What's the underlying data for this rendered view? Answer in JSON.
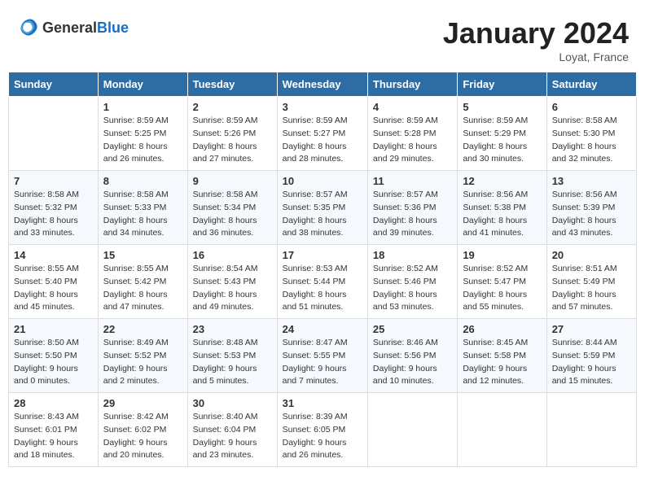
{
  "logo": {
    "general": "General",
    "blue": "Blue"
  },
  "title": "January 2024",
  "location": "Loyat, France",
  "days_of_week": [
    "Sunday",
    "Monday",
    "Tuesday",
    "Wednesday",
    "Thursday",
    "Friday",
    "Saturday"
  ],
  "weeks": [
    [
      {
        "day": "",
        "sunrise": "",
        "sunset": "",
        "daylight": ""
      },
      {
        "day": "1",
        "sunrise": "Sunrise: 8:59 AM",
        "sunset": "Sunset: 5:25 PM",
        "daylight": "Daylight: 8 hours and 26 minutes."
      },
      {
        "day": "2",
        "sunrise": "Sunrise: 8:59 AM",
        "sunset": "Sunset: 5:26 PM",
        "daylight": "Daylight: 8 hours and 27 minutes."
      },
      {
        "day": "3",
        "sunrise": "Sunrise: 8:59 AM",
        "sunset": "Sunset: 5:27 PM",
        "daylight": "Daylight: 8 hours and 28 minutes."
      },
      {
        "day": "4",
        "sunrise": "Sunrise: 8:59 AM",
        "sunset": "Sunset: 5:28 PM",
        "daylight": "Daylight: 8 hours and 29 minutes."
      },
      {
        "day": "5",
        "sunrise": "Sunrise: 8:59 AM",
        "sunset": "Sunset: 5:29 PM",
        "daylight": "Daylight: 8 hours and 30 minutes."
      },
      {
        "day": "6",
        "sunrise": "Sunrise: 8:58 AM",
        "sunset": "Sunset: 5:30 PM",
        "daylight": "Daylight: 8 hours and 32 minutes."
      }
    ],
    [
      {
        "day": "7",
        "sunrise": "Sunrise: 8:58 AM",
        "sunset": "Sunset: 5:32 PM",
        "daylight": "Daylight: 8 hours and 33 minutes."
      },
      {
        "day": "8",
        "sunrise": "Sunrise: 8:58 AM",
        "sunset": "Sunset: 5:33 PM",
        "daylight": "Daylight: 8 hours and 34 minutes."
      },
      {
        "day": "9",
        "sunrise": "Sunrise: 8:58 AM",
        "sunset": "Sunset: 5:34 PM",
        "daylight": "Daylight: 8 hours and 36 minutes."
      },
      {
        "day": "10",
        "sunrise": "Sunrise: 8:57 AM",
        "sunset": "Sunset: 5:35 PM",
        "daylight": "Daylight: 8 hours and 38 minutes."
      },
      {
        "day": "11",
        "sunrise": "Sunrise: 8:57 AM",
        "sunset": "Sunset: 5:36 PM",
        "daylight": "Daylight: 8 hours and 39 minutes."
      },
      {
        "day": "12",
        "sunrise": "Sunrise: 8:56 AM",
        "sunset": "Sunset: 5:38 PM",
        "daylight": "Daylight: 8 hours and 41 minutes."
      },
      {
        "day": "13",
        "sunrise": "Sunrise: 8:56 AM",
        "sunset": "Sunset: 5:39 PM",
        "daylight": "Daylight: 8 hours and 43 minutes."
      }
    ],
    [
      {
        "day": "14",
        "sunrise": "Sunrise: 8:55 AM",
        "sunset": "Sunset: 5:40 PM",
        "daylight": "Daylight: 8 hours and 45 minutes."
      },
      {
        "day": "15",
        "sunrise": "Sunrise: 8:55 AM",
        "sunset": "Sunset: 5:42 PM",
        "daylight": "Daylight: 8 hours and 47 minutes."
      },
      {
        "day": "16",
        "sunrise": "Sunrise: 8:54 AM",
        "sunset": "Sunset: 5:43 PM",
        "daylight": "Daylight: 8 hours and 49 minutes."
      },
      {
        "day": "17",
        "sunrise": "Sunrise: 8:53 AM",
        "sunset": "Sunset: 5:44 PM",
        "daylight": "Daylight: 8 hours and 51 minutes."
      },
      {
        "day": "18",
        "sunrise": "Sunrise: 8:52 AM",
        "sunset": "Sunset: 5:46 PM",
        "daylight": "Daylight: 8 hours and 53 minutes."
      },
      {
        "day": "19",
        "sunrise": "Sunrise: 8:52 AM",
        "sunset": "Sunset: 5:47 PM",
        "daylight": "Daylight: 8 hours and 55 minutes."
      },
      {
        "day": "20",
        "sunrise": "Sunrise: 8:51 AM",
        "sunset": "Sunset: 5:49 PM",
        "daylight": "Daylight: 8 hours and 57 minutes."
      }
    ],
    [
      {
        "day": "21",
        "sunrise": "Sunrise: 8:50 AM",
        "sunset": "Sunset: 5:50 PM",
        "daylight": "Daylight: 9 hours and 0 minutes."
      },
      {
        "day": "22",
        "sunrise": "Sunrise: 8:49 AM",
        "sunset": "Sunset: 5:52 PM",
        "daylight": "Daylight: 9 hours and 2 minutes."
      },
      {
        "day": "23",
        "sunrise": "Sunrise: 8:48 AM",
        "sunset": "Sunset: 5:53 PM",
        "daylight": "Daylight: 9 hours and 5 minutes."
      },
      {
        "day": "24",
        "sunrise": "Sunrise: 8:47 AM",
        "sunset": "Sunset: 5:55 PM",
        "daylight": "Daylight: 9 hours and 7 minutes."
      },
      {
        "day": "25",
        "sunrise": "Sunrise: 8:46 AM",
        "sunset": "Sunset: 5:56 PM",
        "daylight": "Daylight: 9 hours and 10 minutes."
      },
      {
        "day": "26",
        "sunrise": "Sunrise: 8:45 AM",
        "sunset": "Sunset: 5:58 PM",
        "daylight": "Daylight: 9 hours and 12 minutes."
      },
      {
        "day": "27",
        "sunrise": "Sunrise: 8:44 AM",
        "sunset": "Sunset: 5:59 PM",
        "daylight": "Daylight: 9 hours and 15 minutes."
      }
    ],
    [
      {
        "day": "28",
        "sunrise": "Sunrise: 8:43 AM",
        "sunset": "Sunset: 6:01 PM",
        "daylight": "Daylight: 9 hours and 18 minutes."
      },
      {
        "day": "29",
        "sunrise": "Sunrise: 8:42 AM",
        "sunset": "Sunset: 6:02 PM",
        "daylight": "Daylight: 9 hours and 20 minutes."
      },
      {
        "day": "30",
        "sunrise": "Sunrise: 8:40 AM",
        "sunset": "Sunset: 6:04 PM",
        "daylight": "Daylight: 9 hours and 23 minutes."
      },
      {
        "day": "31",
        "sunrise": "Sunrise: 8:39 AM",
        "sunset": "Sunset: 6:05 PM",
        "daylight": "Daylight: 9 hours and 26 minutes."
      },
      {
        "day": "",
        "sunrise": "",
        "sunset": "",
        "daylight": ""
      },
      {
        "day": "",
        "sunrise": "",
        "sunset": "",
        "daylight": ""
      },
      {
        "day": "",
        "sunrise": "",
        "sunset": "",
        "daylight": ""
      }
    ]
  ]
}
